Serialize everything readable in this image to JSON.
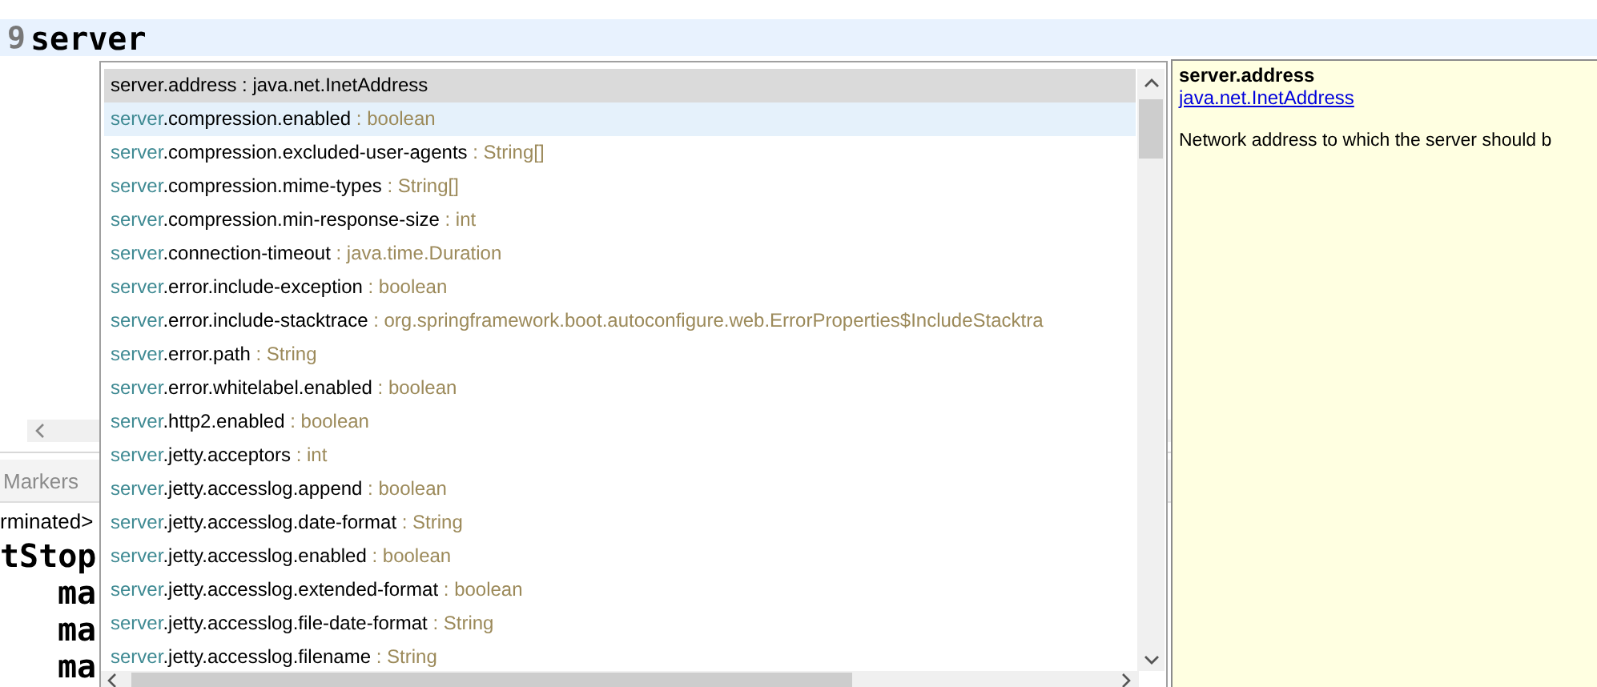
{
  "editor": {
    "lines": [
      {
        "number": "9",
        "text": "server",
        "current": true
      }
    ]
  },
  "console": {
    "tab": "Markers",
    "status": "rminated>",
    "lines": [
      "tStop",
      "ma",
      "ma",
      "ma"
    ]
  },
  "completion": {
    "items": [
      {
        "match": "server",
        "rest": ".address",
        "type": ": java.net.InetAddress",
        "selected": true,
        "hovered": false
      },
      {
        "match": "server",
        "rest": ".compression.enabled",
        "type": ": boolean",
        "selected": false,
        "hovered": true
      },
      {
        "match": "server",
        "rest": ".compression.excluded-user-agents",
        "type": ": String[]",
        "selected": false,
        "hovered": false
      },
      {
        "match": "server",
        "rest": ".compression.mime-types",
        "type": ": String[]",
        "selected": false,
        "hovered": false
      },
      {
        "match": "server",
        "rest": ".compression.min-response-size",
        "type": ": int",
        "selected": false,
        "hovered": false
      },
      {
        "match": "server",
        "rest": ".connection-timeout",
        "type": ": java.time.Duration",
        "selected": false,
        "hovered": false
      },
      {
        "match": "server",
        "rest": ".error.include-exception",
        "type": ": boolean",
        "selected": false,
        "hovered": false
      },
      {
        "match": "server",
        "rest": ".error.include-stacktrace",
        "type": ": org.springframework.boot.autoconfigure.web.ErrorProperties$IncludeStacktra",
        "selected": false,
        "hovered": false
      },
      {
        "match": "server",
        "rest": ".error.path",
        "type": ": String",
        "selected": false,
        "hovered": false
      },
      {
        "match": "server",
        "rest": ".error.whitelabel.enabled",
        "type": ": boolean",
        "selected": false,
        "hovered": false
      },
      {
        "match": "server",
        "rest": ".http2.enabled",
        "type": ": boolean",
        "selected": false,
        "hovered": false
      },
      {
        "match": "server",
        "rest": ".jetty.acceptors",
        "type": ": int",
        "selected": false,
        "hovered": false
      },
      {
        "match": "server",
        "rest": ".jetty.accesslog.append",
        "type": ": boolean",
        "selected": false,
        "hovered": false
      },
      {
        "match": "server",
        "rest": ".jetty.accesslog.date-format",
        "type": ": String",
        "selected": false,
        "hovered": false
      },
      {
        "match": "server",
        "rest": ".jetty.accesslog.enabled",
        "type": ": boolean",
        "selected": false,
        "hovered": false
      },
      {
        "match": "server",
        "rest": ".jetty.accesslog.extended-format",
        "type": ": boolean",
        "selected": false,
        "hovered": false
      },
      {
        "match": "server",
        "rest": ".jetty.accesslog.file-date-format",
        "type": ": String",
        "selected": false,
        "hovered": false
      },
      {
        "match": "server",
        "rest": ".jetty.accesslog.filename",
        "type": ": String",
        "selected": false,
        "hovered": false
      }
    ]
  },
  "doc": {
    "title": "server.address",
    "link": "java.net.InetAddress",
    "description": "Network address to which the server should b"
  }
}
